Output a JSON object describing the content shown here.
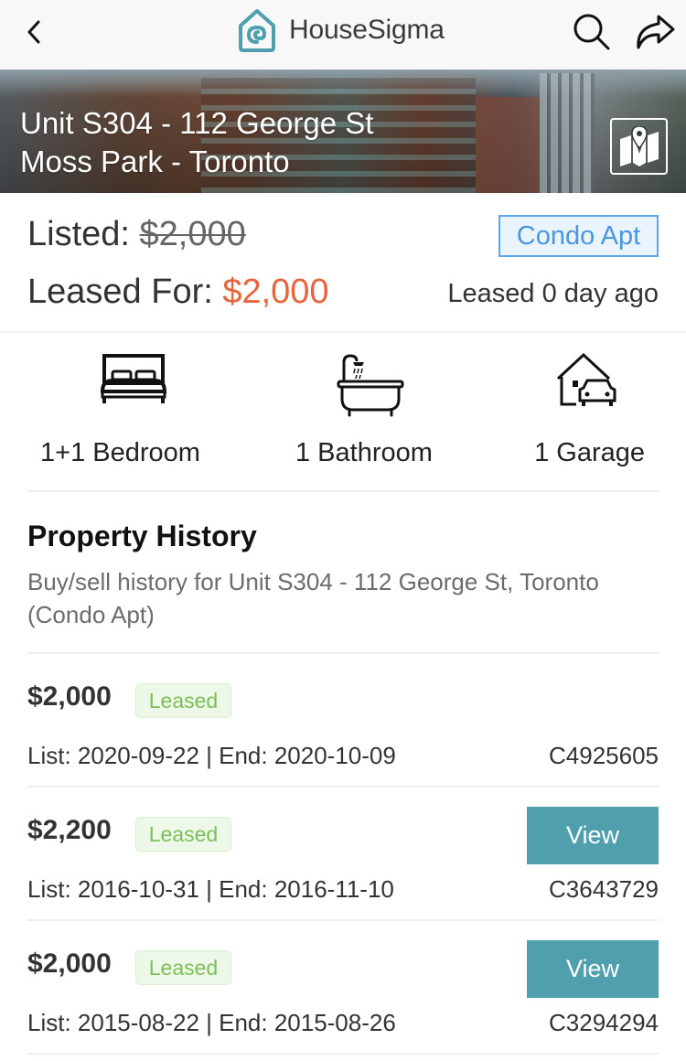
{
  "header": {
    "app_name": "HouseSigma",
    "back_icon": "chevron-left-icon",
    "logo_icon": "house-logo-icon",
    "search_icon": "search-icon",
    "share_icon": "share-icon",
    "brand_color": "#4fa0ae"
  },
  "hero": {
    "address_line1": "Unit S304 - 112 George St",
    "address_line2": "Moss Park - Toronto",
    "map_icon": "map-pin-icon"
  },
  "pricing": {
    "listed_label": "Listed: ",
    "listed_price": "$2,000",
    "leased_label": "Leased For: ",
    "leased_price": "$2,000",
    "leased_price_color": "#e8643c",
    "property_type": "Condo Apt",
    "leased_ago": "Leased 0 day ago"
  },
  "features": [
    {
      "icon": "bed-icon",
      "label": "1+1 Bedroom"
    },
    {
      "icon": "bathtub-icon",
      "label": "1 Bathroom"
    },
    {
      "icon": "garage-icon",
      "label": "1 Garage"
    }
  ],
  "history": {
    "title": "Property History",
    "subtitle": "Buy/sell history for Unit S304 - 112 George St, Toronto (Condo Apt)",
    "rows": [
      {
        "price": "$2,000",
        "status": "Leased",
        "dates": "List: 2020-09-22 | End: 2020-10-09",
        "mls": "C4925605",
        "view_label": null
      },
      {
        "price": "$2,200",
        "status": "Leased",
        "dates": "List: 2016-10-31 | End: 2016-11-10",
        "mls": "C3643729",
        "view_label": "View"
      },
      {
        "price": "$2,000",
        "status": "Leased",
        "dates": "List: 2015-08-22 | End: 2015-08-26",
        "mls": "C3294294",
        "view_label": "View"
      }
    ]
  }
}
